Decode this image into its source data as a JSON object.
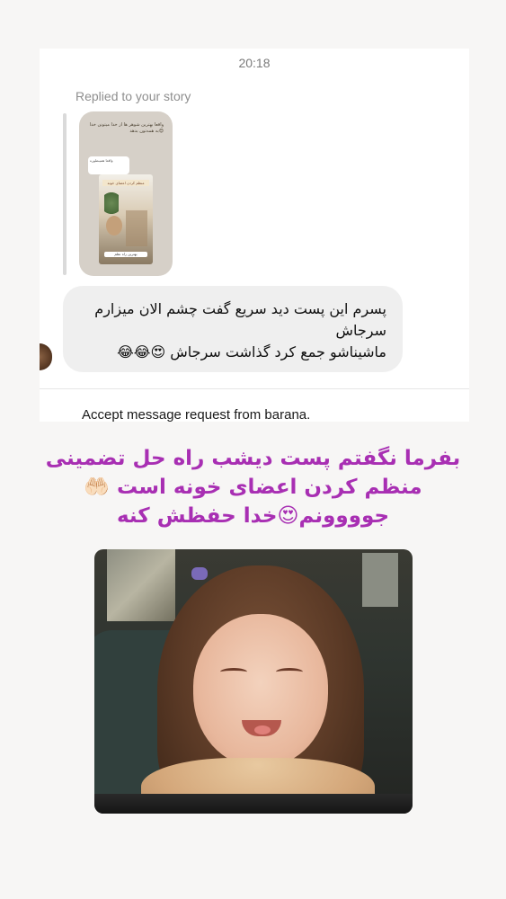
{
  "dm": {
    "time": "20:18",
    "reply_label": "Replied to your story",
    "message_lines": [
      "پسرم این پست دید سریع گفت چشم الان میزارم سرجاش",
      "ماشیناشو جمع کرد گذاشت سرجاش 😍😂😂"
    ],
    "accept_text": "Accept message request from barana."
  },
  "story_thumb": {
    "caption_text": "واقعا بهترین شوهر ها از خدا میتونن خدا به همه‌تون بدهد😍",
    "chat_text": "واقعا همینطوره",
    "tag_text": "منظم کردن اعضای خونه",
    "bottom_text": "بهترین راه نظم"
  },
  "caption": {
    "lines": [
      "بفرما نگفتم پست دیشب راه حل تضمینی",
      "منظم کردن اعضای خونه است 🤲🏻",
      "جوووونم😍خدا حفظش کنه"
    ],
    "color": "#a82fb3"
  }
}
